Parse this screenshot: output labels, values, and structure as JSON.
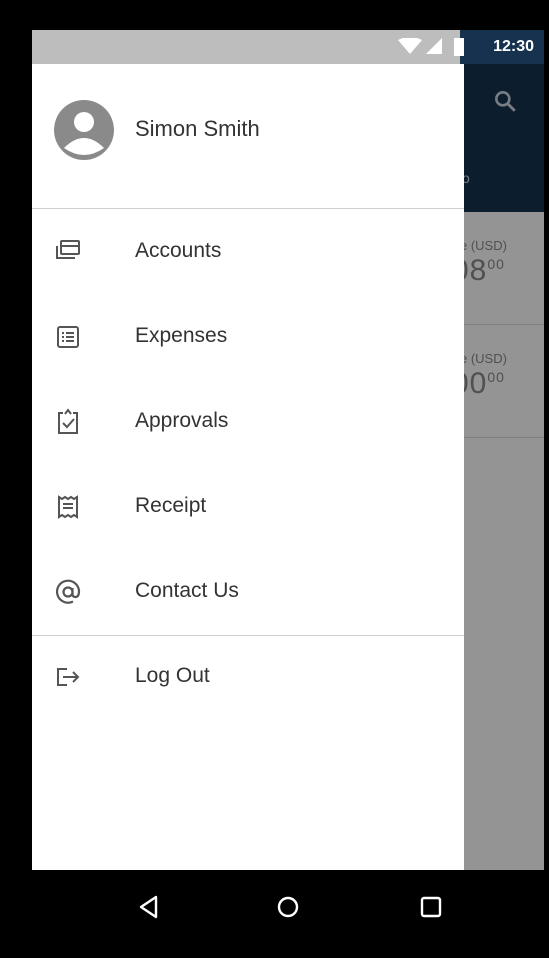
{
  "status_bar": {
    "time": "12:30"
  },
  "profile": {
    "name": "Simon Smith"
  },
  "menu": {
    "items": [
      {
        "label": "Accounts",
        "icon": "accounts-icon"
      },
      {
        "label": "Expenses",
        "icon": "expenses-icon"
      },
      {
        "label": "Approvals",
        "icon": "approvals-icon"
      },
      {
        "label": "Receipt",
        "icon": "receipt-icon"
      },
      {
        "label": "Contact Us",
        "icon": "at-sign-icon"
      }
    ],
    "logout": {
      "label": "Log Out",
      "icon": "logout-icon"
    }
  },
  "background_app": {
    "tab_fragment": "o",
    "cards": [
      {
        "label_fragment": "e (USD)",
        "amount_fragment": "08",
        "cents": "00"
      },
      {
        "label_fragment": "e (USD)",
        "amount_fragment": "00",
        "cents": "00"
      }
    ]
  },
  "colors": {
    "header": "#16324f",
    "drawer": "#ffffff",
    "icon": "#555555",
    "text": "#333333"
  }
}
